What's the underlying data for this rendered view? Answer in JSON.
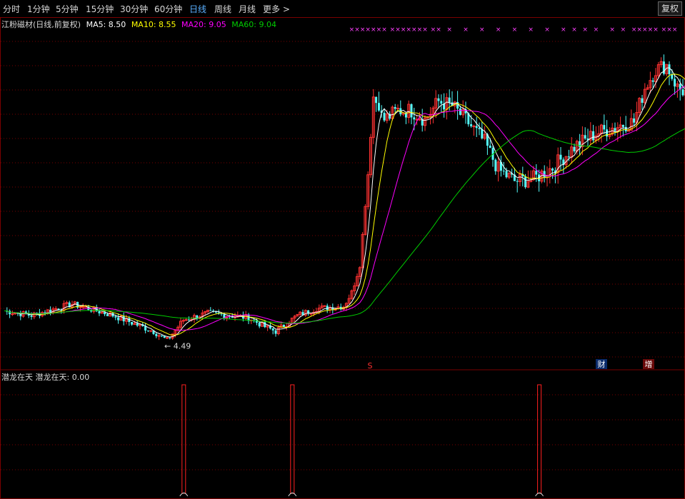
{
  "toolbar": {
    "tabs": [
      "分时",
      "1分钟",
      "5分钟",
      "15分钟",
      "30分钟",
      "60分钟",
      "日线",
      "周线",
      "月线",
      "更多 >"
    ],
    "active_tab": "日线",
    "fq_button": "复权"
  },
  "legend": {
    "stock": "江粉磁材(日线,前复权)",
    "ma5": "MA5: 8.50",
    "ma10": "MA10: 8.55",
    "ma20": "MA20: 9.05",
    "ma60": "MA60: 9.04"
  },
  "indicator": {
    "legend": "潜龙在天  潜龙在天: 0.00"
  },
  "markers": {
    "low_label": "← 4.49",
    "s_marker": "S",
    "cai_marker": "财",
    "zeng_marker": "增",
    "x_row": "×"
  },
  "colors": {
    "up": "#ff3232",
    "down": "#54ffff",
    "ma5": "#ffffff",
    "ma10": "#ffff00",
    "ma20": "#ff00ff",
    "ma60": "#00cc00",
    "grid": "#7a0000",
    "signal_bar": "#ff2020"
  },
  "chart_data": {
    "type": "candlestick",
    "price_range": [
      4.0,
      11.4
    ],
    "low_annotation": 4.49,
    "signal_bars_at_index": [
      66,
      106,
      197
    ],
    "x_marks_at_index": [
      128,
      130,
      132,
      134,
      136,
      138,
      140,
      143,
      145,
      147,
      149,
      151,
      153,
      155,
      158,
      160,
      164,
      170,
      176,
      182,
      188,
      194,
      200,
      206,
      210,
      214,
      218,
      224,
      228,
      232,
      234,
      236,
      238,
      240,
      243,
      245,
      247
    ]
  }
}
